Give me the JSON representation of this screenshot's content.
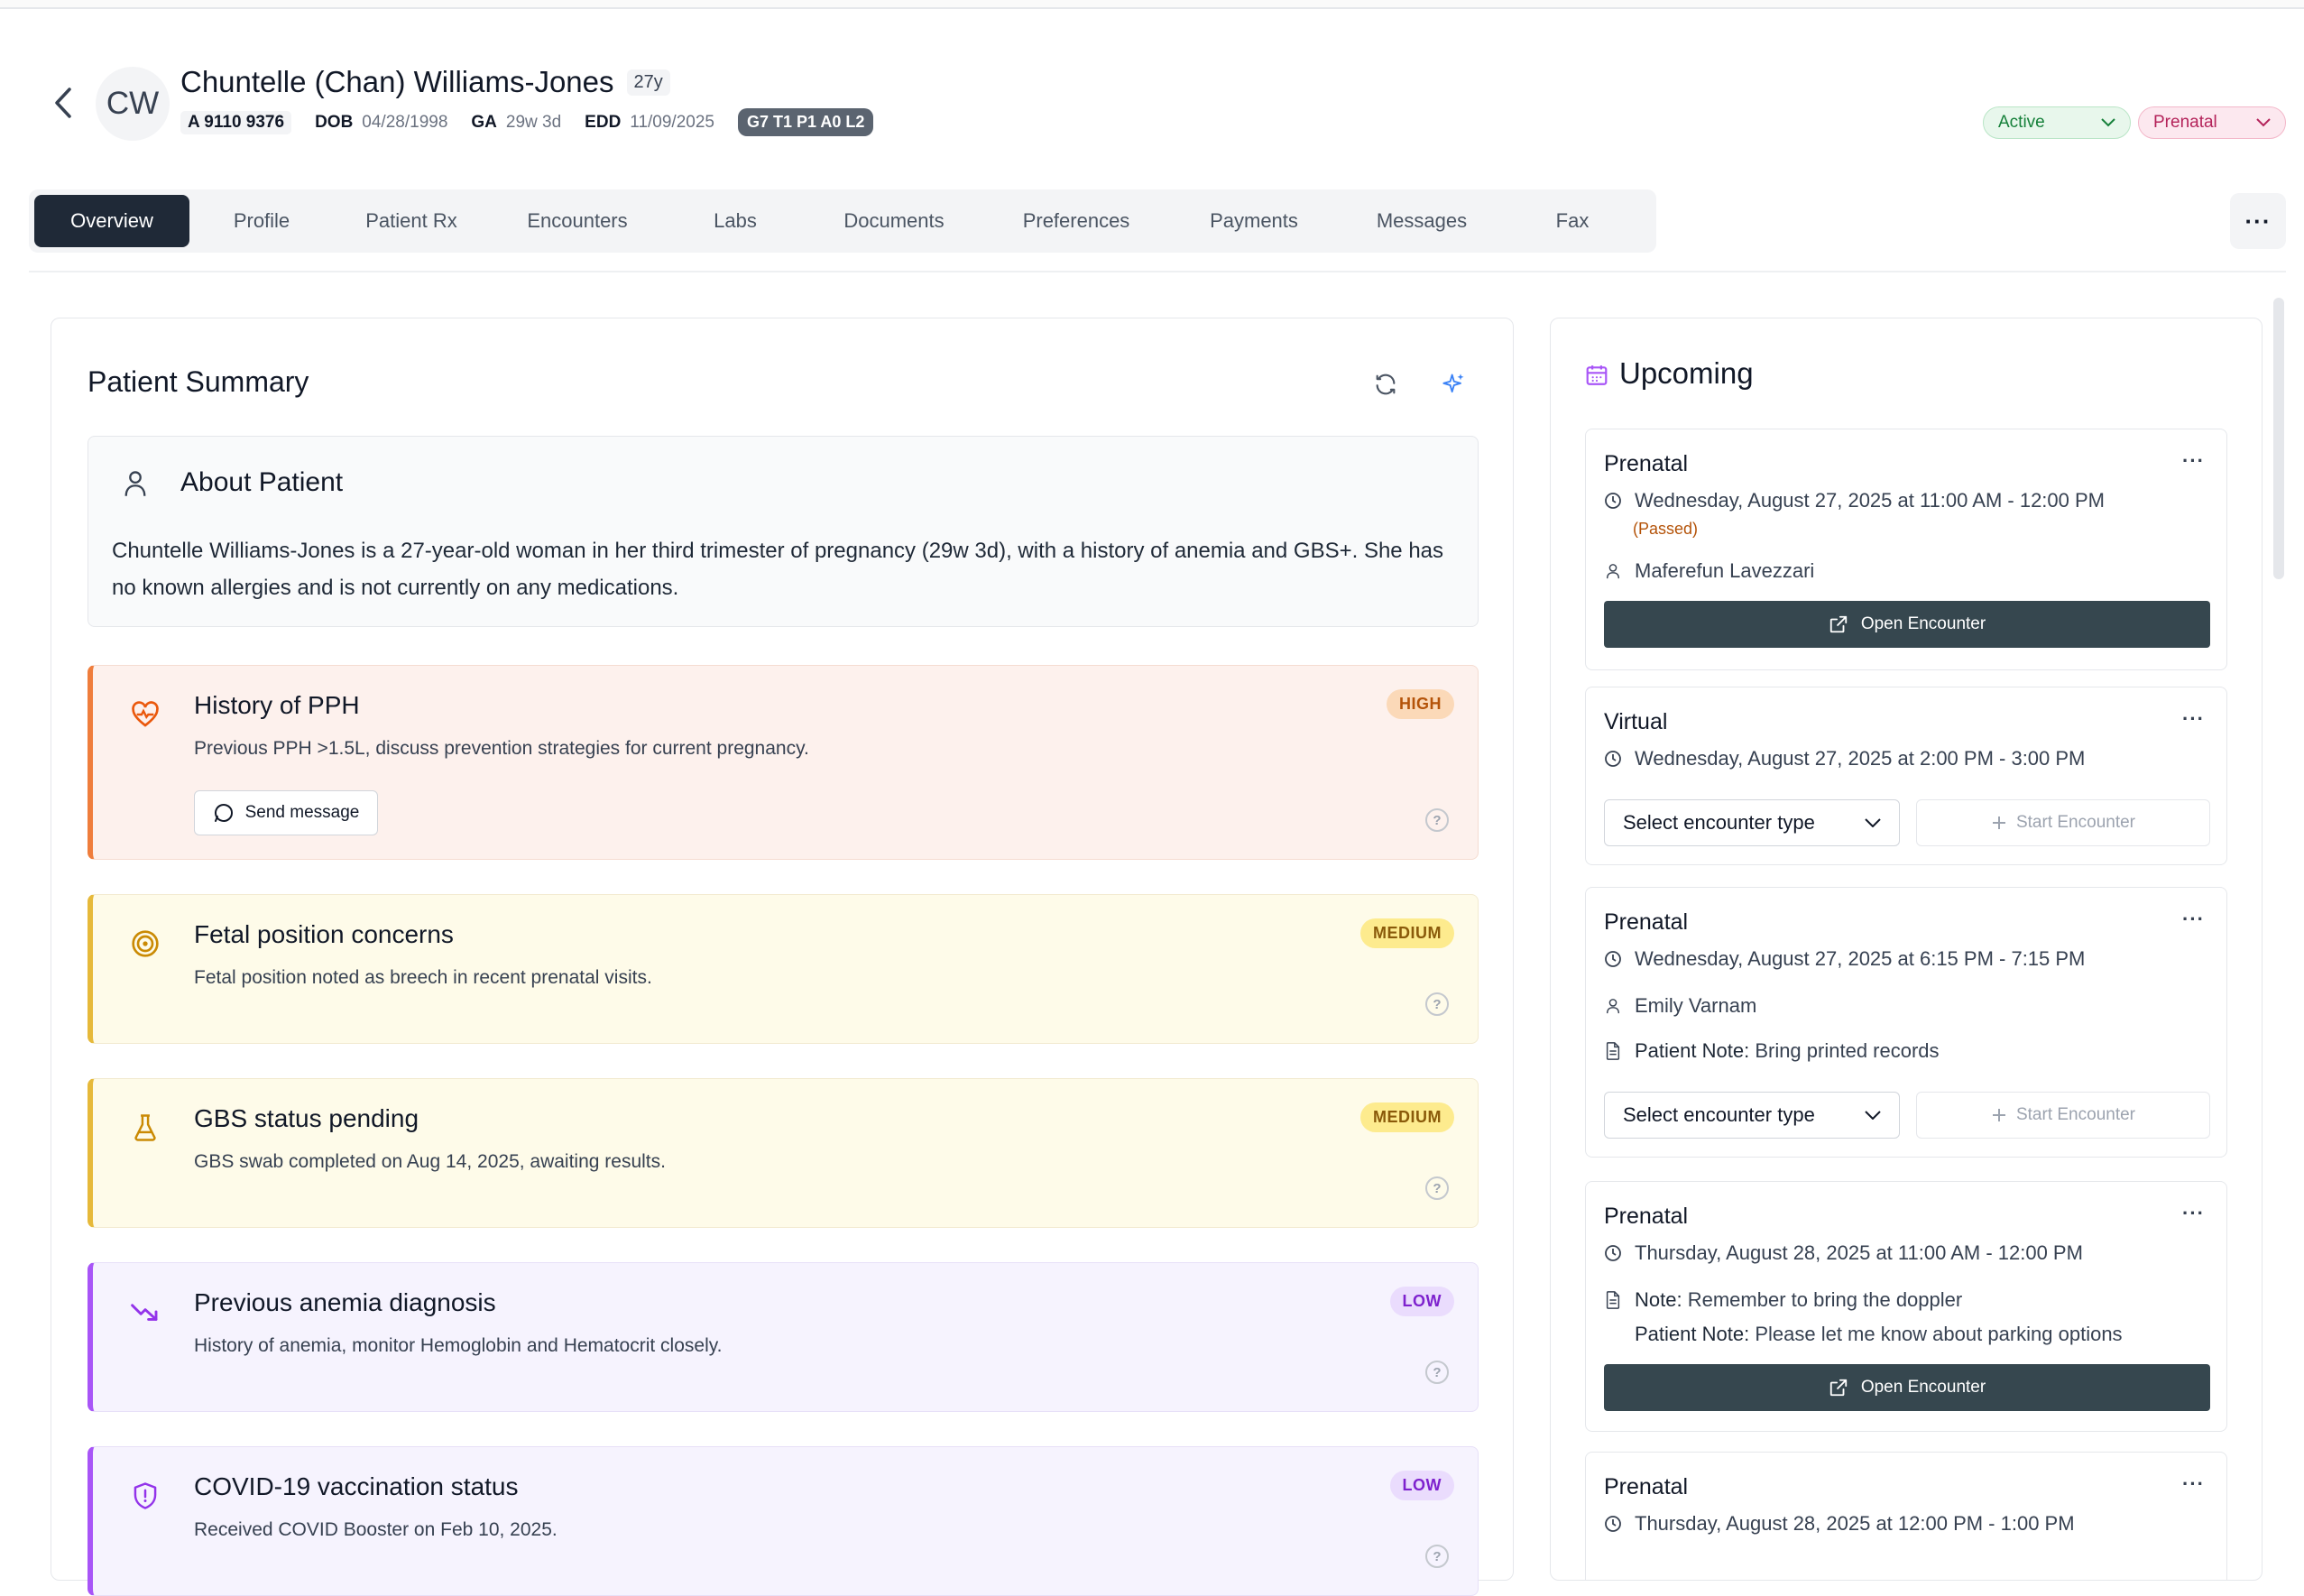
{
  "header": {
    "avatar_initials": "CW",
    "patient_name": "Chuntelle (Chan) Williams-Jones",
    "age": "27y",
    "mrn": "A 9110 9376",
    "dob_label": "DOB",
    "dob": "04/28/1998",
    "ga_label": "GA",
    "ga": "29w 3d",
    "edd_label": "EDD",
    "edd": "11/09/2025",
    "gtpal": "G7 T1 P1 A0 L2",
    "status": "Active",
    "care_type": "Prenatal"
  },
  "tabs": [
    {
      "label": "Overview",
      "active": true
    },
    {
      "label": "Profile"
    },
    {
      "label": "Patient Rx"
    },
    {
      "label": "Encounters"
    },
    {
      "label": "Labs"
    },
    {
      "label": "Documents"
    },
    {
      "label": "Preferences"
    },
    {
      "label": "Payments"
    },
    {
      "label": "Messages"
    },
    {
      "label": "Fax"
    }
  ],
  "more_label": "···",
  "summary": {
    "title": "Patient Summary",
    "about_title": "About Patient",
    "about_text": "Chuntelle Williams-Jones is a 27-year-old woman in her third trimester of pregnancy (29w 3d), with a history of anemia and GBS+. She has no known allergies and is not currently on any medications.",
    "alerts": [
      {
        "title": "History of PPH",
        "description": "Previous PPH >1.5L, discuss prevention strategies for current pregnancy.",
        "severity": "HIGH",
        "action": "Send message",
        "icon": "heart-pulse-icon"
      },
      {
        "title": "Fetal position concerns",
        "description": "Fetal position noted as breech in recent prenatal visits.",
        "severity": "MEDIUM",
        "icon": "target-icon"
      },
      {
        "title": "GBS status pending",
        "description": "GBS swab completed on Aug 14, 2025, awaiting results.",
        "severity": "MEDIUM",
        "icon": "flask-icon"
      },
      {
        "title": "Previous anemia diagnosis",
        "description": "History of anemia, monitor Hemoglobin and Hematocrit closely.",
        "severity": "LOW",
        "icon": "trending-down-icon"
      },
      {
        "title": "COVID-19 vaccination status",
        "description": "Received COVID Booster on Feb 10, 2025.",
        "severity": "LOW",
        "icon": "shield-icon"
      }
    ],
    "help_glyph": "?"
  },
  "upcoming": {
    "title": "Upcoming",
    "open_label": "Open Encounter",
    "select_label": "Select encounter type",
    "start_label": "Start Encounter",
    "note_label": "Note:",
    "patient_note_label": "Patient Note:",
    "cards": [
      {
        "type": "Prenatal",
        "datetime": "Wednesday, August 27, 2025 at 11:00 AM - 12:00 PM",
        "status": "(Passed)",
        "provider": "Maferefun Lavezzari"
      },
      {
        "type": "Virtual",
        "datetime": "Wednesday, August 27, 2025 at 2:00 PM - 3:00 PM"
      },
      {
        "type": "Prenatal",
        "datetime": "Wednesday, August 27, 2025 at 6:15 PM - 7:15 PM",
        "provider": "Emily Varnam",
        "patient_note": "Bring printed records"
      },
      {
        "type": "Prenatal",
        "datetime": "Thursday, August 28, 2025 at 11:00 AM - 12:00 PM",
        "note": "Remember to bring the doppler",
        "patient_note": "Please let me know about parking options"
      },
      {
        "type": "Prenatal",
        "datetime": "Thursday, August 28, 2025 at 12:00 PM - 1:00 PM"
      }
    ]
  },
  "colors": {
    "active_tab": "#1f2937",
    "open_encounter": "#36474f",
    "high": "#ef7d3c",
    "medium": "#e6b93a",
    "low": "#a855f7"
  }
}
